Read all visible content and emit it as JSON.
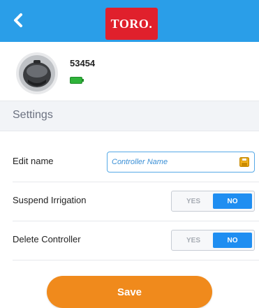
{
  "header": {
    "logo_text": "TORO.",
    "background": "#2a9ee8",
    "logo_color": "#e0202c",
    "back_icon": "chevron-left-icon"
  },
  "device": {
    "id": "53454",
    "battery_icon": "battery-icon",
    "battery_color": "#2fb33a"
  },
  "settings": {
    "title": "Settings",
    "edit_name": {
      "label": "Edit name",
      "value": "",
      "placeholder": "Controller Name",
      "save_icon": "save-icon"
    },
    "suspend_irrigation": {
      "label": "Suspend Irrigation",
      "options": [
        "YES",
        "NO"
      ],
      "selected": "NO"
    },
    "delete_controller": {
      "label": "Delete Controller",
      "options": [
        "YES",
        "NO"
      ],
      "selected": "NO"
    }
  },
  "footer": {
    "save_label": "Save",
    "save_color": "#f08a1c"
  }
}
